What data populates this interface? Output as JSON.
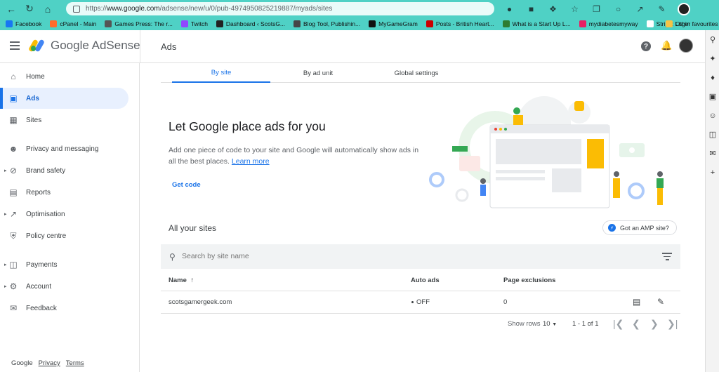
{
  "browser": {
    "url_prefix": "https://",
    "url_domain": "www.google.com",
    "url_path": "/adsense/new/u/0/pub-4974950825219887/myads/sites",
    "bookmarks": [
      {
        "label": "Facebook",
        "color": "#1877f2"
      },
      {
        "label": "cPanel - Main",
        "color": "#ff6c2c"
      },
      {
        "label": "Games Press: The r...",
        "color": "#555555"
      },
      {
        "label": "Twitch",
        "color": "#9146ff"
      },
      {
        "label": "Dashboard ‹ ScotsG...",
        "color": "#222222"
      },
      {
        "label": "Blog Tool, Publishin...",
        "color": "#464646"
      },
      {
        "label": "MyGameGram",
        "color": "#111111"
      },
      {
        "label": "Posts - British Heart...",
        "color": "#cc0000"
      },
      {
        "label": "What is a Start Up L...",
        "color": "#2e7d32"
      },
      {
        "label": "mydiabetesmyway",
        "color": "#e91e63"
      },
      {
        "label": "Stripe: Login",
        "color": "#ffffff"
      }
    ],
    "other_favourites": "Other favourites"
  },
  "header": {
    "app_name": "Google AdSense",
    "page_title": "Ads"
  },
  "nav": {
    "home": "Home",
    "ads": "Ads",
    "sites": "Sites",
    "privacy": "Privacy and messaging",
    "brand_safety": "Brand safety",
    "reports": "Reports",
    "optimisation": "Optimisation",
    "policy": "Policy centre",
    "payments": "Payments",
    "account": "Account",
    "feedback": "Feedback"
  },
  "footer": {
    "google": "Google",
    "privacy": "Privacy",
    "terms": "Terms"
  },
  "tabs": {
    "by_site": "By site",
    "by_ad_unit": "By ad unit",
    "global_settings": "Global settings"
  },
  "hero": {
    "title": "Let Google place ads for you",
    "description": "Add one piece of code to your site and Google will automatically show ads in all the best places.",
    "learn_more": "Learn more",
    "get_code": "Get code"
  },
  "sites": {
    "heading": "All your sites",
    "amp_button": "Got an AMP site?",
    "search_placeholder": "Search by site name",
    "columns": {
      "name": "Name",
      "sort_arrow": "↑",
      "auto_ads": "Auto ads",
      "page_exclusions": "Page exclusions"
    },
    "rows": [
      {
        "name": "scotsgamergeek.com",
        "auto_ads": "OFF",
        "page_exclusions": "0"
      }
    ],
    "pagination": {
      "show_rows_label": "Show rows",
      "rows_value": "10",
      "range": "1 - 1 of 1"
    }
  },
  "colors": {
    "accent": "#1a73e8",
    "browser_chrome": "#4fd1c5"
  }
}
